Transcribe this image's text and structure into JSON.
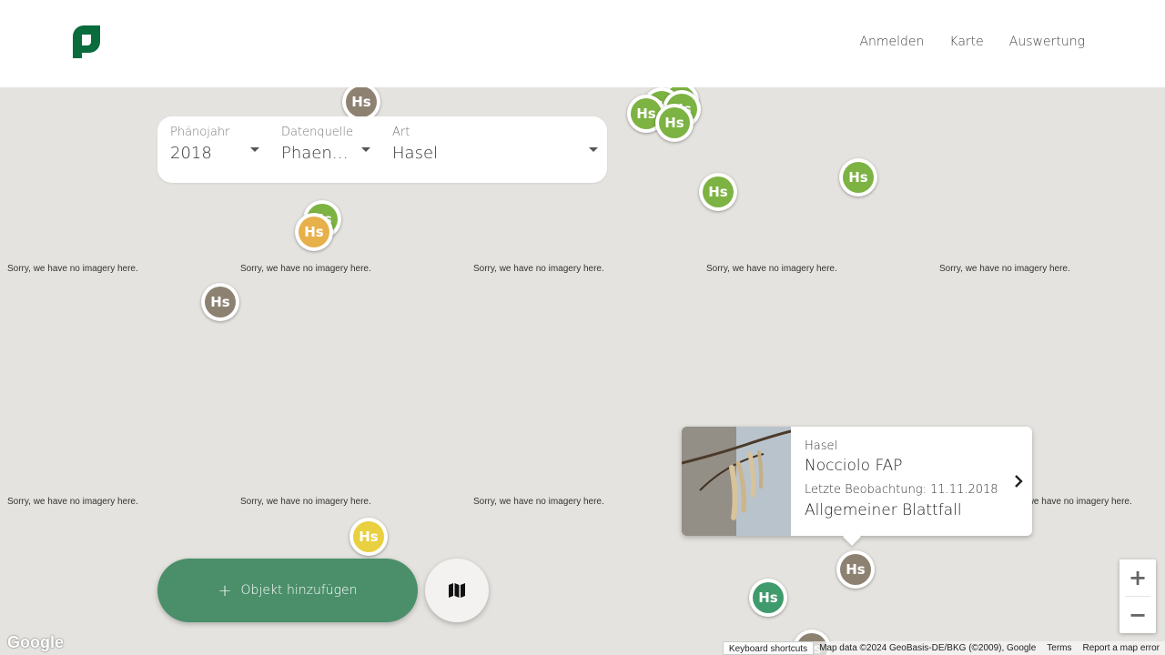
{
  "header": {
    "nav": [
      "Anmelden",
      "Karte",
      "Auswertung"
    ],
    "brand_color": "#0a6b3d"
  },
  "filter": {
    "year": {
      "label": "Phänojahr",
      "value": "2018"
    },
    "source": {
      "label": "Datenquelle",
      "value": "Phaeno..."
    },
    "species": {
      "label": "Art",
      "value": "Hasel"
    }
  },
  "map": {
    "no_imagery_text": "Sorry, we have no imagery here.",
    "marker_label": "Hs",
    "marker_colors": {
      "green": "#7cb342",
      "gray": "#8d8272",
      "orange": "#e8b04a",
      "yellow": "#e8d040",
      "teal": "#3f9a6c"
    }
  },
  "info_card": {
    "species": "Hasel",
    "name": "Nocciolo FAP",
    "last_observation": "Letzte Beobachtung: 11.11.2018",
    "phase": "Allgemeiner Blattfall"
  },
  "actions": {
    "add_plus": "+",
    "add_label": "Objekt hinzufügen",
    "map_icon": "map-icon"
  },
  "zoom": {
    "in": "+",
    "out": "−"
  },
  "footer": {
    "google": "Google",
    "keyboard": "Keyboard shortcuts",
    "map_data": "Map data ©2024 GeoBasis-DE/BKG (©2009), Google",
    "terms": "Terms",
    "report": "Report a map error"
  }
}
